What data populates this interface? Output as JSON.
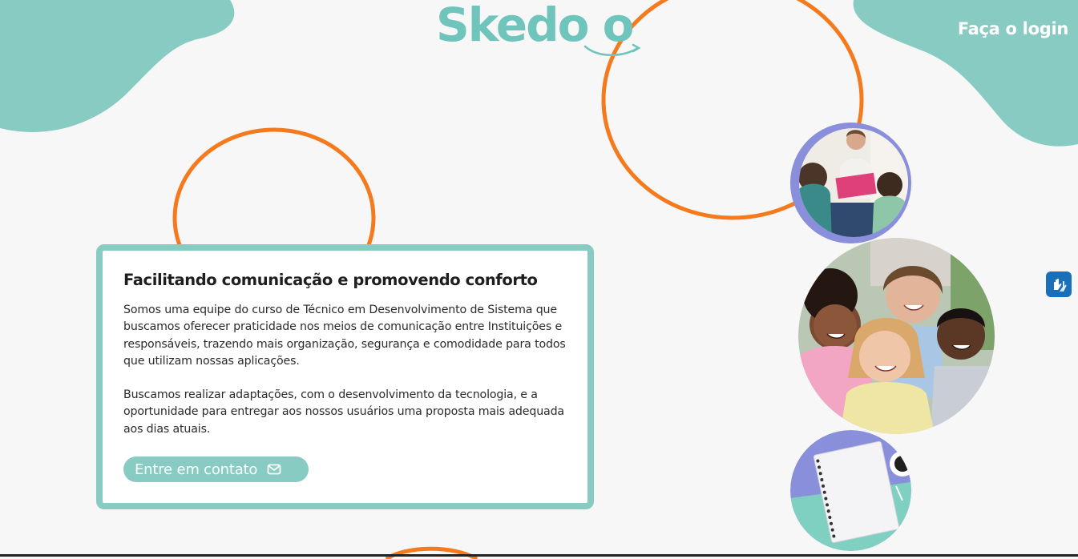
{
  "header": {
    "logo_text": "Skedo o",
    "login_label": "Faça o login"
  },
  "card": {
    "title": "Facilitando comunicação e promovendo conforto",
    "paragraph_1": "Somos uma equipe do curso de Técnico em Desenvolvimento de Sistema que buscamos oferecer praticidade nos meios de comunicação entre Instituições e responsáveis, trazendo mais organização, segurança e comodidade para todos que utilizam nossas aplicações.",
    "paragraph_2": "Buscamos realizar adaptações, com o desenvolvimento da tecnologia, e a oportunidade para entregar aos nossos usuários uma proposta mais adequada aos dias atuais.",
    "contact_label": "Entre em contato",
    "contact_icon": "mail-icon"
  },
  "images": {
    "photo_1": "teacher-reading-to-children-image",
    "photo_2": "smiling-children-group-image",
    "photo_3": "notebook-on-desk-image"
  },
  "accessibility": {
    "icon": "sign-language-hands-icon"
  },
  "colors": {
    "teal": "#87cbc3",
    "orange": "#f5791d",
    "lavender": "#8a8fdc",
    "background": "#f7f7f7",
    "accessibility_blue": "#1a6fba"
  }
}
